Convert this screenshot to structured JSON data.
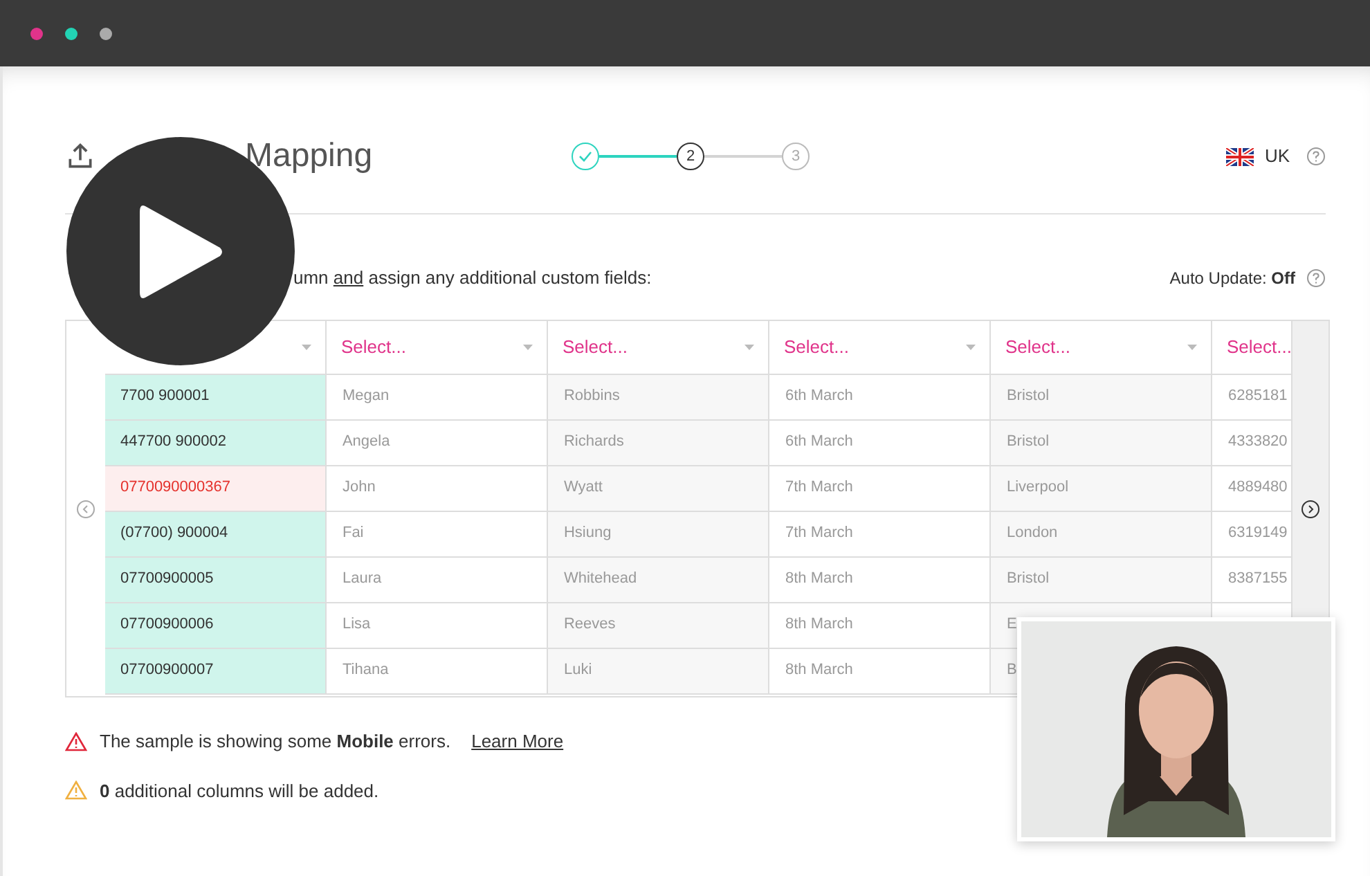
{
  "window": {
    "dots": [
      {
        "color": "#e0338a"
      },
      {
        "color": "#22d3b4"
      },
      {
        "color": "#aaaaaa"
      }
    ]
  },
  "header": {
    "title": "Mapping",
    "steps": [
      {
        "completed": true,
        "current": false
      },
      {
        "label": "2",
        "completed": false,
        "current": true
      },
      {
        "label": "3",
        "completed": false,
        "current": false
      }
    ],
    "region": "UK"
  },
  "instruction": {
    "before": "umn",
    "link": "and",
    "after": "assign any additional custom fields:"
  },
  "auto_update": {
    "label": "Auto Update:",
    "value": "Off"
  },
  "table": {
    "columns": [
      {
        "caret": true
      },
      {
        "label": "Select...",
        "caret": true
      },
      {
        "label": "Select...",
        "caret": true
      },
      {
        "label": "Select...",
        "caret": true
      },
      {
        "label": "Select...",
        "caret": true
      },
      {
        "label": "Select...",
        "caret": false
      }
    ],
    "rows": [
      {
        "error": false,
        "cells": [
          "7700 900001",
          "Megan",
          "Robbins",
          "6th March",
          "Bristol",
          "6285181"
        ]
      },
      {
        "error": false,
        "cells": [
          "447700 900002",
          "Angela",
          "Richards",
          "6th March",
          "Bristol",
          "4333820"
        ]
      },
      {
        "error": true,
        "cells": [
          "0770090000367",
          "John",
          "Wyatt",
          "7th March",
          "Liverpool",
          "4889480"
        ]
      },
      {
        "error": false,
        "cells": [
          "(07700) 900004",
          "Fai",
          "Hsiung",
          "7th March",
          "London",
          "6319149"
        ]
      },
      {
        "error": false,
        "cells": [
          "07700900005",
          "Laura",
          "Whitehead",
          "8th March",
          "Bristol",
          "8387155"
        ]
      },
      {
        "error": false,
        "cells": [
          "07700900006",
          "Lisa",
          "Reeves",
          "8th March",
          "E"
        ]
      },
      {
        "error": false,
        "cells": [
          "07700900007",
          "Tihana",
          "Luki",
          "8th March",
          "B"
        ]
      }
    ]
  },
  "messages": [
    {
      "kind": "error",
      "text": "The sample is showing some **Mobile** errors.",
      "link": "Learn More"
    },
    {
      "kind": "warning",
      "text": "**0** additional columns will be added."
    }
  ]
}
